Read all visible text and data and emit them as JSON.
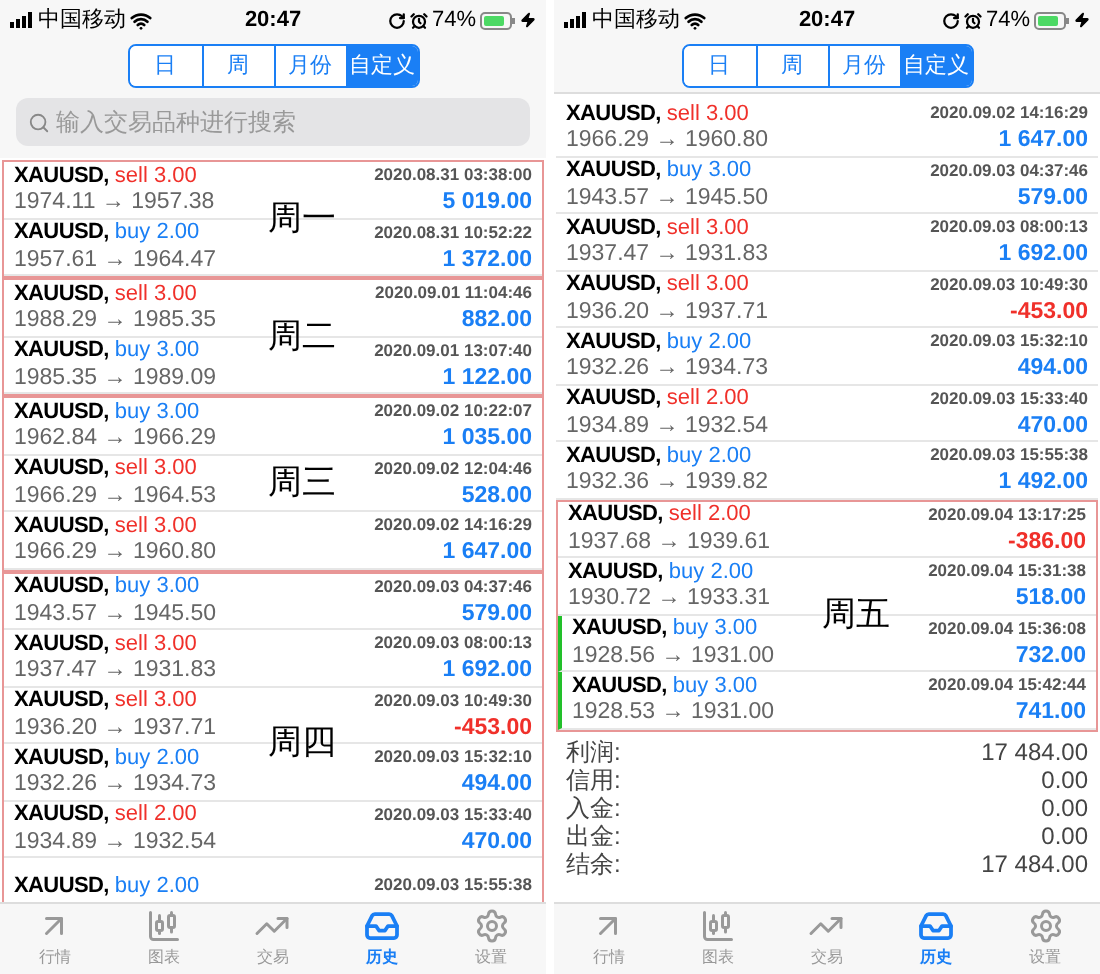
{
  "screens": [
    {
      "status_bar": {
        "carrier": "中国移动",
        "time": "20:47",
        "battery": "74%"
      },
      "segments": [
        {
          "label": "日",
          "selected": false
        },
        {
          "label": "周",
          "selected": false
        },
        {
          "label": "月份",
          "selected": false
        },
        {
          "label": "自定义",
          "selected": true
        }
      ],
      "search": {
        "placeholder": "输入交易品种进行搜索"
      },
      "groups": [
        {
          "boxed": true,
          "label": "周一",
          "trades": [
            {
              "symbol": "XAUUSD,",
              "order": "sell 3.00",
              "kind": "sell",
              "time": "2020.08.31 03:38:00",
              "prices": "1974.11 → 1957.38",
              "profit": "5 019.00",
              "loss": false
            },
            {
              "symbol": "XAUUSD,",
              "order": "buy 2.00",
              "kind": "buy",
              "time": "2020.08.31 10:52:22",
              "prices": "1957.61 → 1964.47",
              "profit": "1 372.00",
              "loss": false
            }
          ]
        },
        {
          "boxed": true,
          "label": "周二",
          "trades": [
            {
              "symbol": "XAUUSD,",
              "order": "sell 3.00",
              "kind": "sell",
              "time": "2020.09.01 11:04:46",
              "prices": "1988.29 → 1985.35",
              "profit": "882.00",
              "loss": false
            },
            {
              "symbol": "XAUUSD,",
              "order": "buy 3.00",
              "kind": "buy",
              "time": "2020.09.01 13:07:40",
              "prices": "1985.35 → 1989.09",
              "profit": "1 122.00",
              "loss": false
            }
          ]
        },
        {
          "boxed": true,
          "label": "周三",
          "trades": [
            {
              "symbol": "XAUUSD,",
              "order": "buy 3.00",
              "kind": "buy",
              "time": "2020.09.02 10:22:07",
              "prices": "1962.84 → 1966.29",
              "profit": "1 035.00",
              "loss": false
            },
            {
              "symbol": "XAUUSD,",
              "order": "sell 3.00",
              "kind": "sell",
              "time": "2020.09.02 12:04:46",
              "prices": "1966.29 → 1964.53",
              "profit": "528.00",
              "loss": false
            },
            {
              "symbol": "XAUUSD,",
              "order": "sell 3.00",
              "kind": "sell",
              "time": "2020.09.02 14:16:29",
              "prices": "1966.29 → 1960.80",
              "profit": "1 647.00",
              "loss": false
            }
          ]
        },
        {
          "boxed": true,
          "label": "周四",
          "trades": [
            {
              "symbol": "XAUUSD,",
              "order": "buy 3.00",
              "kind": "buy",
              "time": "2020.09.03 04:37:46",
              "prices": "1943.57 → 1945.50",
              "profit": "579.00",
              "loss": false
            },
            {
              "symbol": "XAUUSD,",
              "order": "sell 3.00",
              "kind": "sell",
              "time": "2020.09.03 08:00:13",
              "prices": "1937.47 → 1931.83",
              "profit": "1 692.00",
              "loss": false
            },
            {
              "symbol": "XAUUSD,",
              "order": "sell 3.00",
              "kind": "sell",
              "time": "2020.09.03 10:49:30",
              "prices": "1936.20 → 1937.71",
              "profit": "-453.00",
              "loss": true
            },
            {
              "symbol": "XAUUSD,",
              "order": "buy 2.00",
              "kind": "buy",
              "time": "2020.09.03 15:32:10",
              "prices": "1932.26 → 1934.73",
              "profit": "494.00",
              "loss": false
            },
            {
              "symbol": "XAUUSD,",
              "order": "sell 2.00",
              "kind": "sell",
              "time": "2020.09.03 15:33:40",
              "prices": "1934.89 → 1932.54",
              "profit": "470.00",
              "loss": false
            },
            {
              "symbol": "XAUUSD,",
              "order": "buy 2.00",
              "kind": "buy",
              "time": "2020.09.03 15:55:38"
            }
          ]
        }
      ],
      "tab_bar": [
        {
          "label": "行情",
          "selected": false
        },
        {
          "label": "图表",
          "selected": false
        },
        {
          "label": "交易",
          "selected": false
        },
        {
          "label": "历史",
          "selected": true
        },
        {
          "label": "设置",
          "selected": false
        }
      ]
    },
    {
      "status_bar": {
        "carrier": "中国移动",
        "time": "20:47",
        "battery": "74%"
      },
      "segments": [
        {
          "label": "日",
          "selected": false
        },
        {
          "label": "周",
          "selected": false
        },
        {
          "label": "月份",
          "selected": false
        },
        {
          "label": "自定义",
          "selected": true
        }
      ],
      "groups": [
        {
          "boxed": false,
          "trades": [
            {
              "symbol": "XAUUSD,",
              "order": "sell 3.00",
              "kind": "sell",
              "time": "2020.09.02 14:16:29",
              "prices": "1966.29 → 1960.80",
              "profit": "1 647.00",
              "loss": false
            },
            {
              "symbol": "XAUUSD,",
              "order": "buy 3.00",
              "kind": "buy",
              "time": "2020.09.03 04:37:46",
              "prices": "1943.57 → 1945.50",
              "profit": "579.00",
              "loss": false
            },
            {
              "symbol": "XAUUSD,",
              "order": "sell 3.00",
              "kind": "sell",
              "time": "2020.09.03 08:00:13",
              "prices": "1937.47 → 1931.83",
              "profit": "1 692.00",
              "loss": false
            },
            {
              "symbol": "XAUUSD,",
              "order": "sell 3.00",
              "kind": "sell",
              "time": "2020.09.03 10:49:30",
              "prices": "1936.20 → 1937.71",
              "profit": "-453.00",
              "loss": true
            },
            {
              "symbol": "XAUUSD,",
              "order": "buy 2.00",
              "kind": "buy",
              "time": "2020.09.03 15:32:10",
              "prices": "1932.26 → 1934.73",
              "profit": "494.00",
              "loss": false
            },
            {
              "symbol": "XAUUSD,",
              "order": "sell 2.00",
              "kind": "sell",
              "time": "2020.09.03 15:33:40",
              "prices": "1934.89 → 1932.54",
              "profit": "470.00",
              "loss": false
            },
            {
              "symbol": "XAUUSD,",
              "order": "buy 2.00",
              "kind": "buy",
              "time": "2020.09.03 15:55:38",
              "prices": "1932.36 → 1939.82",
              "profit": "1 492.00",
              "loss": false
            }
          ]
        },
        {
          "boxed": true,
          "label": "周五",
          "trades": [
            {
              "symbol": "XAUUSD,",
              "order": "sell 2.00",
              "kind": "sell",
              "time": "2020.09.04 13:17:25",
              "prices": "1937.68 → 1939.61",
              "profit": "-386.00",
              "loss": true
            },
            {
              "symbol": "XAUUSD,",
              "order": "buy 2.00",
              "kind": "buy",
              "time": "2020.09.04 15:31:38",
              "prices": "1930.72 → 1933.31",
              "profit": "518.00",
              "loss": false
            },
            {
              "symbol": "XAUUSD,",
              "order": "buy 3.00",
              "kind": "buy",
              "time": "2020.09.04 15:36:08",
              "prices": "1928.56 → 1931.00",
              "profit": "732.00",
              "loss": false,
              "flagged": true
            },
            {
              "symbol": "XAUUSD,",
              "order": "buy 3.00",
              "kind": "buy",
              "time": "2020.09.04 15:42:44",
              "prices": "1928.53 → 1931.00",
              "profit": "741.00",
              "loss": false,
              "flagged": true
            }
          ]
        }
      ],
      "summary": [
        {
          "label": "利润:",
          "value": "17 484.00"
        },
        {
          "label": "信用:",
          "value": "0.00"
        },
        {
          "label": "入金:",
          "value": "0.00"
        },
        {
          "label": "出金:",
          "value": "0.00"
        },
        {
          "label": "结余:",
          "value": "17 484.00"
        }
      ],
      "tab_bar": [
        {
          "label": "行情",
          "selected": false
        },
        {
          "label": "图表",
          "selected": false
        },
        {
          "label": "交易",
          "selected": false
        },
        {
          "label": "历史",
          "selected": true
        },
        {
          "label": "设置",
          "selected": false
        }
      ]
    }
  ]
}
